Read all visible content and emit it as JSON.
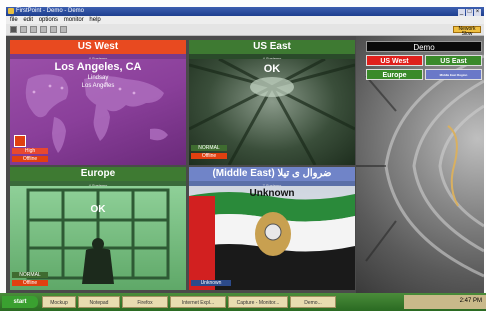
{
  "window": {
    "title": "FirstPoint - Demo - Demo",
    "menu": [
      "file",
      "edit",
      "options",
      "monitor",
      "help"
    ],
    "toolbar_right_label": "Nework Slow"
  },
  "tiles": [
    {
      "header": "US West",
      "subtitle": "4 Systems",
      "place": "Los Angeles, CA",
      "lines": [
        "Lindsay",
        "Los Angeles"
      ],
      "status_top": "High",
      "status_bottom": "Offline",
      "colors": {
        "header": "#e84a20",
        "scene": "#8a3f9a"
      }
    },
    {
      "header": "US East",
      "subtitle": "4 Systems",
      "place": "OK",
      "status_top": "NORMAL",
      "status_bottom": "Offline",
      "colors": {
        "header": "#3e7a32",
        "scene": "#3a4e3a"
      }
    },
    {
      "header": "Europe",
      "subtitle": "4 Systems",
      "place": "OK",
      "status_top": "NORMAL",
      "status_bottom": "Offline",
      "colors": {
        "header": "#3e7a32",
        "scene": "#6ab870"
      }
    },
    {
      "header": "(Middle East) ضروال ى تيلا",
      "subtitle": "7 Systems",
      "place": "Unknown",
      "status_top": "Unknown",
      "colors": {
        "header": "#7084c8",
        "scene": "#dde2ea"
      }
    }
  ],
  "side": {
    "demo_label": "Demo",
    "regions": [
      "US West",
      "US East",
      "Europe",
      "Middle East Region"
    ]
  },
  "taskbar": {
    "start_label": "start",
    "items": [
      "Mockup",
      "Notepad",
      "Firefox",
      "Internet Expl...",
      "Capture - Monitor...",
      "Demo..."
    ],
    "clock": "2:47 PM"
  }
}
